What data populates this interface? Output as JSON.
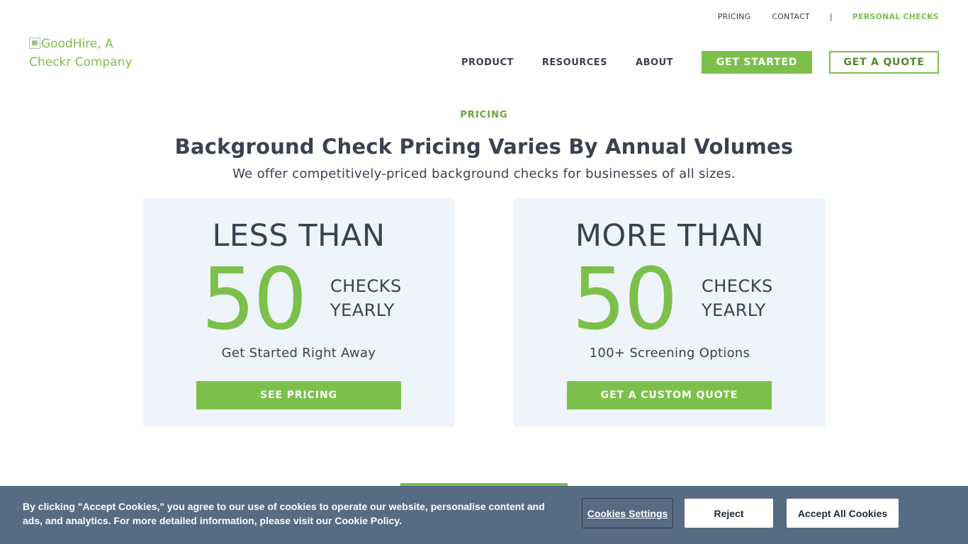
{
  "topbar": {
    "pricing": "PRICING",
    "contact": "CONTACT",
    "separator": "|",
    "personal_checks": "PERSONAL CHECKS"
  },
  "logo": {
    "alt_text": "GoodHire, A Checkr Company"
  },
  "nav": {
    "product": "PRODUCT",
    "resources": "RESOURCES",
    "about": "ABOUT",
    "get_started": "GET STARTED",
    "get_quote": "GET A QUOTE"
  },
  "hero": {
    "eyebrow": "PRICING",
    "headline": "Background Check Pricing Varies By Annual Volumes",
    "subhead": "We offer competitively-priced background checks for businesses of all sizes."
  },
  "cards": [
    {
      "top": "LESS THAN",
      "number": "50",
      "unit_line1": "CHECKS",
      "unit_line2": "YEARLY",
      "desc": "Get Started Right Away",
      "button": "SEE PRICING"
    },
    {
      "top": "MORE THAN",
      "number": "50",
      "unit_line1": "CHECKS",
      "unit_line2": "YEARLY",
      "desc": "100+ Screening Options",
      "button": "GET A CUSTOM QUOTE"
    }
  ],
  "cookie_banner": {
    "text": "By clicking \"Accept Cookies,\" you agree to our use of cookies to operate our website, personalise content and ads, and analytics. For more detailed information, please visit our Cookie Policy.",
    "settings": "Cookies Settings",
    "reject": "Reject",
    "accept": "Accept All Cookies"
  },
  "colors": {
    "brand_green": "#7cc04b",
    "text_dark": "#3a4150",
    "card_bg": "#eef4fa",
    "cookie_bg": "#576b82"
  }
}
